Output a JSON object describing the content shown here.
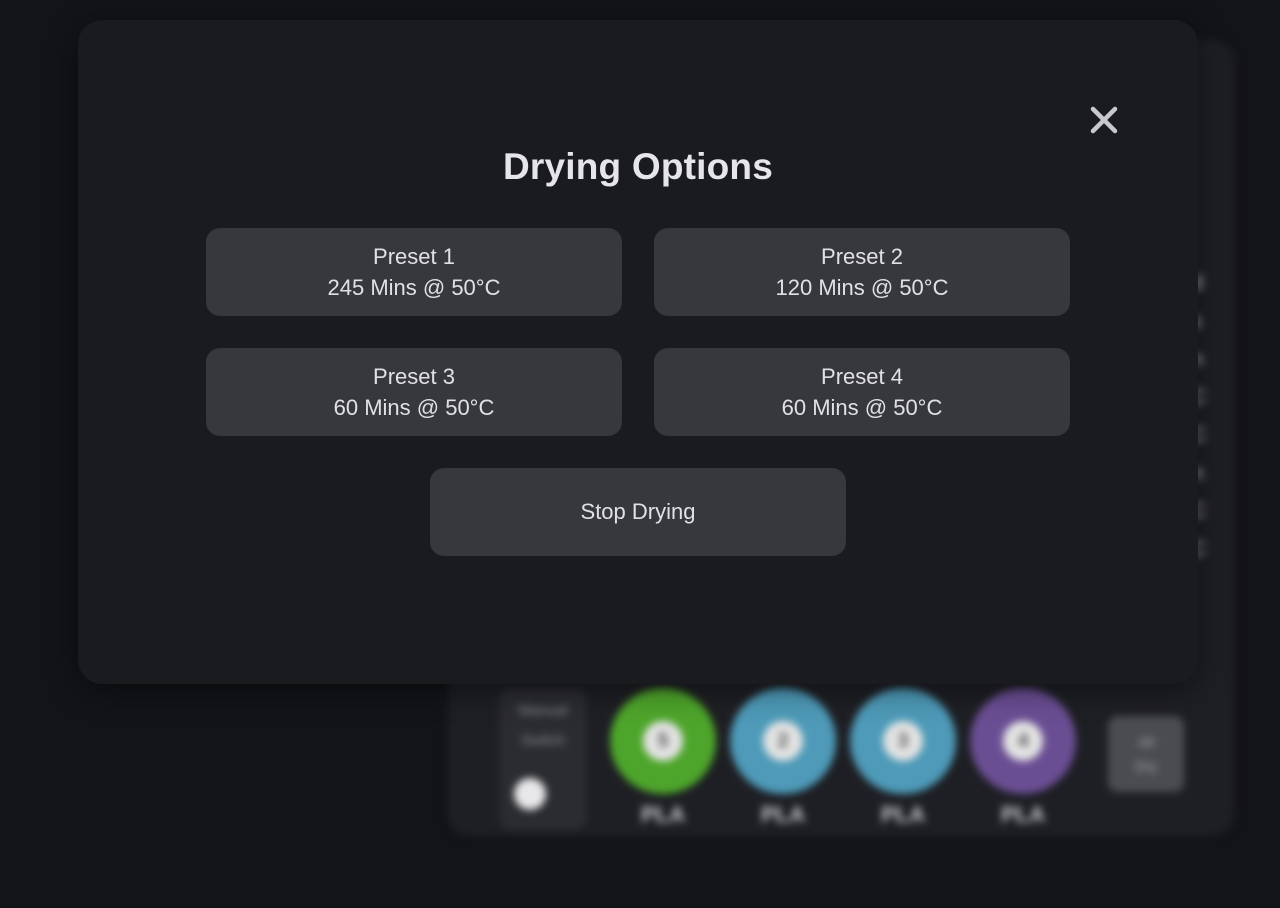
{
  "dialog": {
    "title": "Drying Options",
    "close_icon": "close-icon",
    "presets": [
      {
        "name": "Preset 1",
        "detail": "245 Mins @ 50°C"
      },
      {
        "name": "Preset 2",
        "detail": "120 Mins @ 50°C"
      },
      {
        "name": "Preset 3",
        "detail": "60 Mins @ 50°C"
      },
      {
        "name": "Preset 4",
        "detail": "60 Mins @ 50°C"
      }
    ],
    "stop_label": "Stop Drying"
  },
  "background": {
    "manual_switch": {
      "line1": "Manual",
      "line2": "Switch"
    },
    "spools": [
      {
        "number": "5",
        "material": "PLA",
        "color": "#4ea52b"
      },
      {
        "number": "2",
        "material": "PLA",
        "color": "#4e9ab8"
      },
      {
        "number": "3",
        "material": "PLA",
        "color": "#4e9ab8"
      },
      {
        "number": "4",
        "material": "PLA",
        "color": "#6a4e93"
      }
    ],
    "action_button": {
      "line1": "All",
      "line2": "Dry"
    }
  },
  "colors": {
    "modal_bg": "#1a1b1f",
    "button_bg": "#37383d",
    "text": "#e1e1e5"
  }
}
